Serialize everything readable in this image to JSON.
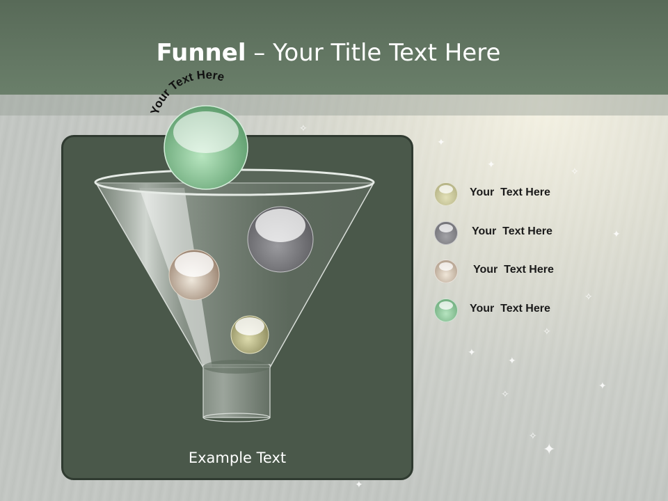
{
  "slide": {
    "title_bold": "Funnel",
    "title_rest": " – Your Title Text Here",
    "arc_text": "Your Text Here",
    "example_text": "Example Text"
  },
  "legend": [
    {
      "label": "Your  Text Here",
      "color": "#b8b78a"
    },
    {
      "label": "Your  Text Here",
      "color": "#8c8c90"
    },
    {
      "label": "Your  Text Here",
      "color": "#c4b39e"
    },
    {
      "label": "Your  Text Here",
      "color": "#7fbf8e"
    }
  ],
  "colors": {
    "header": "#5f725f",
    "panel": "#4a584a",
    "accent_green": "#7fbf8e"
  }
}
